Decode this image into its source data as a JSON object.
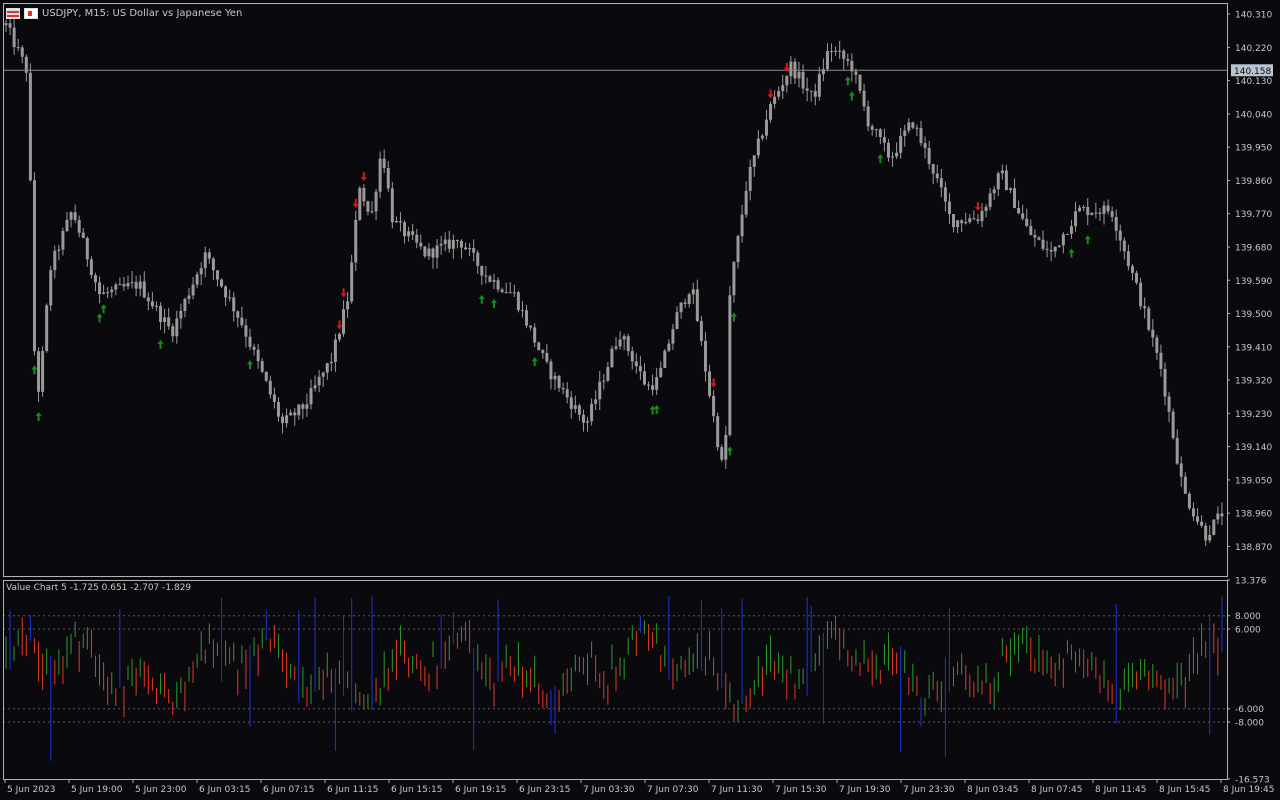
{
  "window": {
    "symbol_title": "USDJPY, M15:  US Dollar vs Japanese Yen",
    "menu_icon": "chart-menu-icon",
    "terminal_icon": "trade-terminal-icon"
  },
  "colors": {
    "background": "#0a0a0e",
    "frame": "#b4b4b4",
    "candle": "#9a9a9a",
    "arrow_up": "#1a8a1a",
    "arrow_down": "#e01414",
    "bar_red": "#e03a2a",
    "bar_green": "#2e9a2e",
    "bar_blue": "#1e32d8",
    "bid_label_bg": "#b8c4d0"
  },
  "chart_data": [
    {
      "type": "candlestick",
      "title": "USDJPY, M15:  US Dollar vs Japanese Yen",
      "ylim": [
        138.79,
        140.34
      ],
      "y_ticks": [
        "140.310",
        "140.220",
        "140.130",
        "140.040",
        "139.950",
        "139.860",
        "139.770",
        "139.680",
        "139.590",
        "139.500",
        "139.410",
        "139.320",
        "139.230",
        "139.140",
        "139.050",
        "138.960",
        "138.870"
      ],
      "current_price": "140.158",
      "x_tick_labels": [
        "5 Jun 2023",
        "5 Jun 19:00",
        "5 Jun 23:00",
        "6 Jun 03:15",
        "6 Jun 07:15",
        "6 Jun 11:15",
        "6 Jun 15:15",
        "6 Jun 19:15",
        "6 Jun 23:15",
        "7 Jun 03:30",
        "7 Jun 07:30",
        "7 Jun 11:30",
        "7 Jun 15:30",
        "7 Jun 19:30",
        "7 Jun 23:30",
        "8 Jun 03:45",
        "8 Jun 07:45",
        "8 Jun 11:45",
        "8 Jun 15:45",
        "8 Jun 19:45"
      ],
      "candle_count": 300,
      "price_path": [
        [
          0,
          140.28
        ],
        [
          8,
          140.15
        ],
        [
          10,
          139.42
        ],
        [
          12,
          139.28
        ],
        [
          16,
          139.62
        ],
        [
          24,
          139.78
        ],
        [
          34,
          139.55
        ],
        [
          48,
          139.58
        ],
        [
          60,
          139.45
        ],
        [
          72,
          139.66
        ],
        [
          85,
          139.48
        ],
        [
          100,
          139.2
        ],
        [
          108,
          139.25
        ],
        [
          118,
          139.38
        ],
        [
          124,
          139.55
        ],
        [
          128,
          139.85
        ],
        [
          132,
          139.75
        ],
        [
          136,
          139.95
        ],
        [
          140,
          139.75
        ],
        [
          152,
          139.66
        ],
        [
          164,
          139.7
        ],
        [
          174,
          139.6
        ],
        [
          184,
          139.55
        ],
        [
          196,
          139.35
        ],
        [
          210,
          139.2
        ],
        [
          222,
          139.45
        ],
        [
          232,
          139.3
        ],
        [
          236,
          139.32
        ],
        [
          242,
          139.48
        ],
        [
          248,
          139.58
        ],
        [
          256,
          139.22
        ],
        [
          260,
          139.05
        ],
        [
          262,
          139.56
        ],
        [
          268,
          139.85
        ],
        [
          276,
          140.05
        ],
        [
          284,
          140.17
        ],
        [
          292,
          140.08
        ],
        [
          298,
          140.22
        ],
        [
          306,
          140.17
        ],
        [
          312,
          140.02
        ],
        [
          320,
          139.92
        ],
        [
          328,
          140.02
        ],
        [
          336,
          139.88
        ],
        [
          342,
          139.75
        ],
        [
          352,
          139.76
        ],
        [
          360,
          139.88
        ],
        [
          370,
          139.72
        ],
        [
          378,
          139.66
        ],
        [
          388,
          139.78
        ],
        [
          400,
          139.78
        ],
        [
          410,
          139.55
        ],
        [
          418,
          139.35
        ],
        [
          426,
          139.02
        ],
        [
          434,
          138.9
        ],
        [
          440,
          138.96
        ]
      ],
      "price_path_x_max": 440,
      "signal_arrows": [
        {
          "dir": "up",
          "i": 10
        },
        {
          "dir": "up",
          "i": 12
        },
        {
          "dir": "up",
          "i": 34
        },
        {
          "dir": "up",
          "i": 36
        },
        {
          "dir": "up",
          "i": 56
        },
        {
          "dir": "up",
          "i": 88
        },
        {
          "dir": "down",
          "i": 120
        },
        {
          "dir": "down",
          "i": 122
        },
        {
          "dir": "down",
          "i": 127
        },
        {
          "dir": "down",
          "i": 129
        },
        {
          "dir": "up",
          "i": 172
        },
        {
          "dir": "up",
          "i": 176
        },
        {
          "dir": "up",
          "i": 192
        },
        {
          "dir": "up",
          "i": 234
        },
        {
          "dir": "up",
          "i": 236
        },
        {
          "dir": "down",
          "i": 256
        },
        {
          "dir": "up",
          "i": 262
        },
        {
          "dir": "up",
          "i": 264
        },
        {
          "dir": "down",
          "i": 276
        },
        {
          "dir": "down",
          "i": 282
        },
        {
          "dir": "up",
          "i": 304
        },
        {
          "dir": "up",
          "i": 306
        },
        {
          "dir": "up",
          "i": 316
        },
        {
          "dir": "down",
          "i": 352
        },
        {
          "dir": "up",
          "i": 386
        },
        {
          "dir": "up",
          "i": 392
        }
      ]
    },
    {
      "type": "bar",
      "title": "Value Chart 5 -1.725 0.651 -2.707 -1.829",
      "ylim": [
        -16.573,
        13.376
      ],
      "y_ticks": [
        "13.376",
        "8.000",
        "6.000",
        "-6.000",
        "-8.000",
        "-16.573"
      ],
      "levels": [
        8,
        6,
        -6,
        -8
      ],
      "bar_count": 300
    }
  ]
}
